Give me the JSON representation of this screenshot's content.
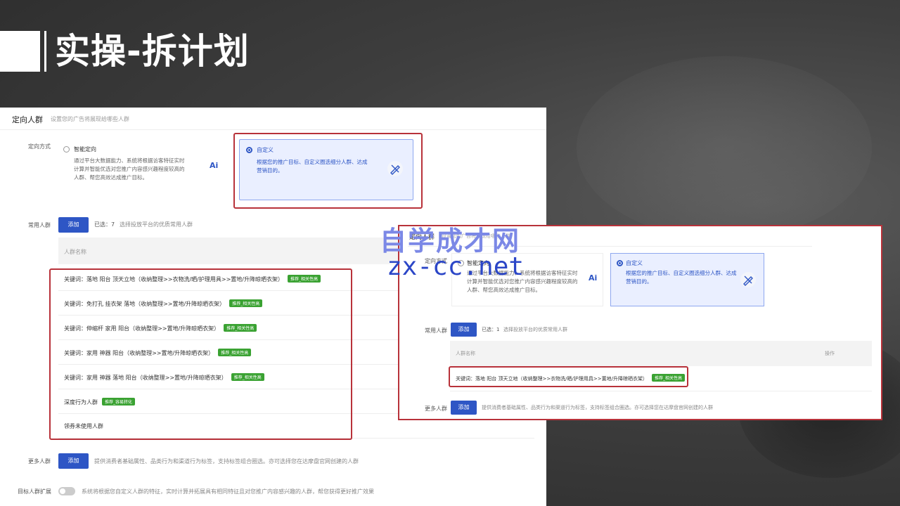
{
  "slide": {
    "title": "实操-拆计划"
  },
  "left_panel": {
    "section_title": "定向人群",
    "section_subtitle": "设置您的广告将展现给哪些人群",
    "targeting": {
      "label": "定向方式",
      "smart": {
        "title": "智能定向",
        "desc1": "通过平台大数据能力、系统将根据访客特征实时",
        "desc2": "计算并智能优选对您推广内容感兴趣程度较高的",
        "desc3": "人群、帮您高效达成推广目标。",
        "icon_text": "Ai"
      },
      "custom": {
        "title": "自定义",
        "desc1": "根据您的推广目标、自定义圈选细分人群、达成",
        "desc2": "营销目的。"
      }
    },
    "common_crowd": {
      "label": "常用人群",
      "add_label": "添加",
      "selected_text": "已选：7",
      "hint": "选择投放平台的优质常用人群",
      "table_header": "人群名称",
      "rows": [
        {
          "text": "关键词：落地 阳台 顶天立地（收纳整理>>衣物洗/晒/护理用具>>置地/升降晾晒衣架）",
          "tag": "推荐_相关性高"
        },
        {
          "text": "关键词：免打孔 挂衣架 落地（收纳整理>>置地/升降晾晒衣架）",
          "tag": "推荐_相关性高"
        },
        {
          "text": "关键词：伸缩杆 家用 阳台（收纳整理>>置地/升降晾晒衣架）",
          "tag": "推荐_相关性高"
        },
        {
          "text": "关键词：家用 神器 阳台（收纳整理>>置地/升降晾晒衣架）",
          "tag": "推荐_相关性高"
        },
        {
          "text": "关键词：家用 神器 落地 阳台（收纳整理>>置地/升降晾晒衣架）",
          "tag": "推荐_相关性高"
        },
        {
          "text": "深度行为人群",
          "tag": "推荐_容易转化"
        },
        {
          "text": "领券未使用人群",
          "tag": ""
        }
      ]
    },
    "more_crowd": {
      "label": "更多人群",
      "add_label": "添加",
      "hint": "提供消费者基础属性、品类行为和渠道行为标签，支持标签组合圈选。亦可选择您在达摩盘官网创建的人群"
    },
    "expand": {
      "label": "目标人群扩展",
      "hint": "系统将根据您自定义人群的特征，实时计算并拓展具有相同特征且对您推广内容感兴趣的人群，帮您获得更好推广效果"
    }
  },
  "right_panel": {
    "section_title": "定向人群",
    "section_subtitle": "设置您的广告将展现给哪些人群",
    "targeting": {
      "label": "定向方式",
      "smart_title": "智能定向",
      "smart_desc1": "通过平台大数据能力、系统将根据访客特征实时",
      "smart_desc2": "计算并智能优选对您推广内容感兴趣程度较高的",
      "smart_desc3": "人群、帮您高效达成推广目标。",
      "custom_title": "自定义",
      "custom_desc1": "根据您的推广目标、自定义圈选细分人群、达成",
      "custom_desc2": "营销目的。"
    },
    "common_crowd": {
      "label": "常用人群",
      "add_label": "添加",
      "selected_text": "已选：1",
      "hint": "选择投放平台的优质常用人群",
      "table_header": "人群名称",
      "table_op": "操作",
      "row_text": "关键词：落地 阳台 顶天立地（收纳整理>>衣物洗/晒/护理用具>>置地/升降晾晒衣架）",
      "row_tag": "推荐_相关性高"
    },
    "more_crowd": {
      "label": "更多人群",
      "add_label": "添加",
      "hint": "提供消费者基础属性、品类行为和渠道行为标签，支持标签组合圈选。亦可选择您在达摩盘官网创建的人群"
    }
  },
  "watermark": {
    "logo_text": "自学成才网",
    "url": "zx-cc.net"
  }
}
